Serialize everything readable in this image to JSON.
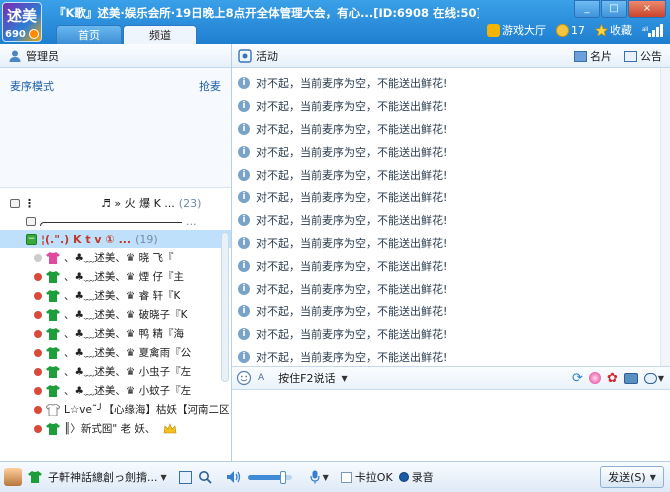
{
  "window": {
    "title": "『K歌』述美·娱乐会所·19日晚上8点开全体管理大会，有心...[ID:6908 在线:50]",
    "logo_text_top": "述美",
    "logo_text_bottom": "690",
    "tabs": [
      {
        "label": "首页"
      },
      {
        "label": "频道"
      }
    ],
    "top_links": {
      "game_hall": "游戏大厅",
      "coins": "17",
      "favorite": "收藏",
      "signal": "all"
    },
    "buttons": {
      "minimize": "_",
      "restore": "□",
      "close": "×"
    }
  },
  "left_panel": {
    "header": "管理员",
    "mic_queue": {
      "label": "麦序模式",
      "action": "抢麦"
    },
    "groups": [
      {
        "name": "♬ » 火 爆 K ...",
        "count": "(23)"
      },
      {
        "name": "...",
        "count": ""
      },
      {
        "name": "¦(.\".)  K t v ①  ...",
        "count": "(19)"
      }
    ],
    "users": [
      {
        "name": "、♣﹏述美、♛ 晓 飞『",
        "status": "off"
      },
      {
        "name": "、♣﹏述美、♛ 煙 仔『主",
        "status": "red"
      },
      {
        "name": "、♣﹏述美、♛ 睿 轩『K",
        "status": "red"
      },
      {
        "name": "、♣﹏述美、♛ 破晓子『K",
        "status": "red"
      },
      {
        "name": "、♣﹏述美、♛ 鸭 精『海",
        "status": "red"
      },
      {
        "name": "、♣﹏述美、♛ 夏禽雨『公",
        "status": "red"
      },
      {
        "name": "、♣﹏述美、♛ 小虫子『左",
        "status": "red"
      },
      {
        "name": "、♣﹏述美、♛ 小蚊子『左",
        "status": "red"
      },
      {
        "name": "L☆ve˜╯【心缘海】枯妖【河南二区",
        "status": "red"
      },
      {
        "name": "║〉新式囮\" 老 妖、",
        "status": "red"
      }
    ]
  },
  "right_panel": {
    "header": "活动",
    "right_links": {
      "card": "名片",
      "notice": "公告"
    },
    "messages": [
      "对不起，当前麦序为空，不能送出鲜花!",
      "对不起，当前麦序为空，不能送出鲜花!",
      "对不起，当前麦序为空，不能送出鲜花!",
      "对不起，当前麦序为空，不能送出鲜花!",
      "对不起，当前麦序为空，不能送出鲜花!",
      "对不起，当前麦序为空，不能送出鲜花!",
      "对不起，当前麦序为空，不能送出鲜花!",
      "对不起，当前麦序为空，不能送出鲜花!",
      "对不起，当前麦序为空，不能送出鲜花!",
      "对不起，当前麦序为空，不能送出鲜花!",
      "对不起，当前麦序为空，不能送出鲜花!",
      "对不起，当前麦序为空，不能送出鲜花!",
      "对不起，当前麦序为空，不能送出鲜花!"
    ],
    "input_toolbar": {
      "talk_mode": "按住F2说话"
    }
  },
  "bottom_bar": {
    "nickname": "子軒神話總創っ劍揹...",
    "volume_level": 0.8,
    "karaoke": "卡拉OK",
    "record": "录音",
    "send": "发送(S)"
  },
  "colors": {
    "title_bar": "#1f7fd0",
    "selected_row": "#bfe0fb",
    "accent_green": "#3aa83a",
    "shirt_green": "#1e9e3a",
    "shirt_pink": "#e24aa0"
  }
}
